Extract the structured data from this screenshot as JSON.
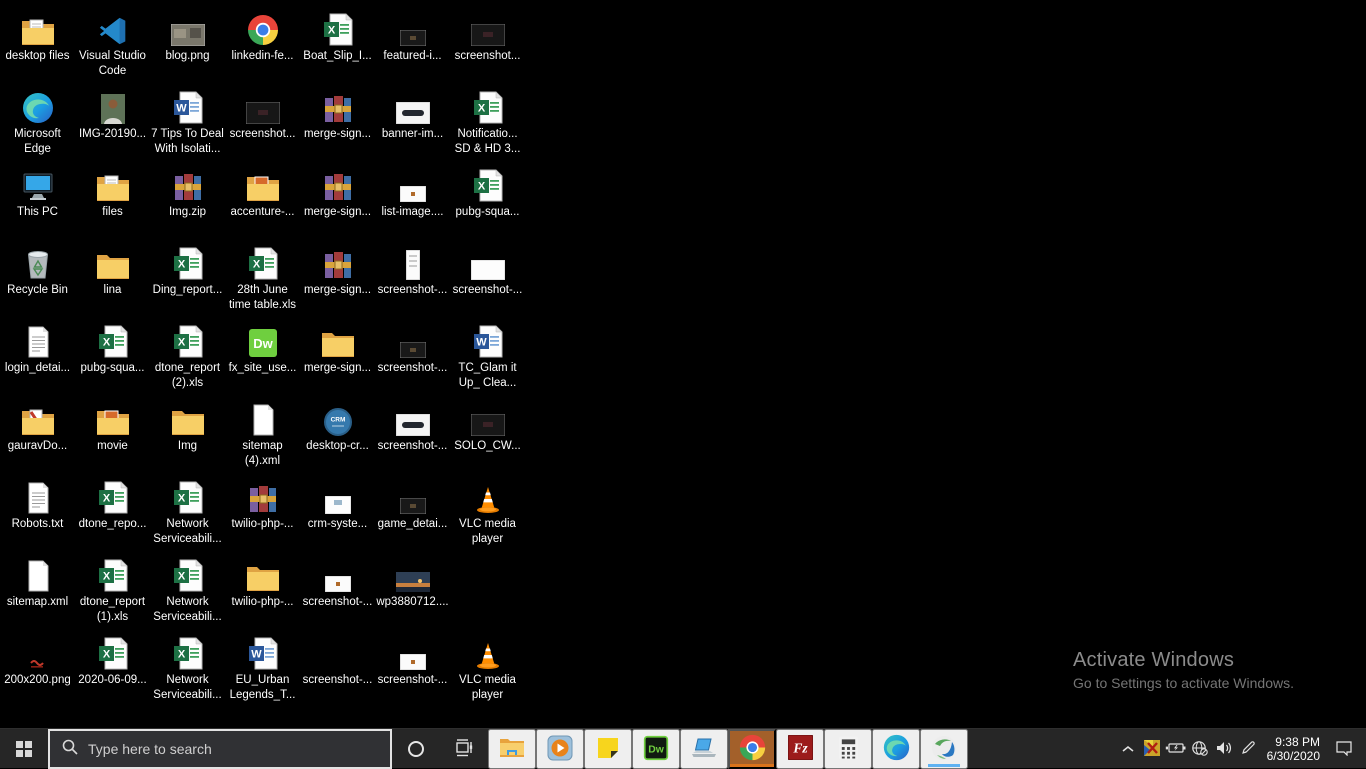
{
  "colors": {
    "wallpaper": "#000000",
    "taskbar": "#262626",
    "active_app_highlight": "#a3602a",
    "active_app_underline": "#d9731c",
    "running_app_underline": "#5fb2f2",
    "icon_label": "#ffffff",
    "watermark_text": "#8b8b8b"
  },
  "desktop": {
    "icons": [
      {
        "row": 0,
        "col": 0,
        "label": "desktop files",
        "icon": "folder_docs"
      },
      {
        "row": 0,
        "col": 1,
        "label": "Visual Studio Code",
        "icon": "vscode"
      },
      {
        "row": 0,
        "col": 2,
        "label": "blog.png",
        "icon": "img_gray"
      },
      {
        "row": 0,
        "col": 3,
        "label": "linkedin-fe...",
        "icon": "chrome"
      },
      {
        "row": 0,
        "col": 4,
        "label": "Boat_Slip_I...",
        "icon": "excel"
      },
      {
        "row": 0,
        "col": 5,
        "label": "featured-i...",
        "icon": "img_dark_sm"
      },
      {
        "row": 0,
        "col": 6,
        "label": "screenshot...",
        "icon": "img_dark"
      },
      {
        "row": 1,
        "col": 0,
        "label": "Microsoft Edge",
        "icon": "edge"
      },
      {
        "row": 1,
        "col": 1,
        "label": "IMG-20190...",
        "icon": "photo"
      },
      {
        "row": 1,
        "col": 2,
        "label": "7 Tips To Deal With Isolati...",
        "icon": "word"
      },
      {
        "row": 1,
        "col": 3,
        "label": "screenshot...",
        "icon": "img_dark"
      },
      {
        "row": 1,
        "col": 4,
        "label": "merge-sign...",
        "icon": "winrar"
      },
      {
        "row": 1,
        "col": 5,
        "label": "banner-im...",
        "icon": "img_band"
      },
      {
        "row": 1,
        "col": 6,
        "label": "Notificatio... SD & HD 3...",
        "icon": "excel"
      },
      {
        "row": 2,
        "col": 0,
        "label": "This PC",
        "icon": "thispc"
      },
      {
        "row": 2,
        "col": 1,
        "label": "files",
        "icon": "folder_docs"
      },
      {
        "row": 2,
        "col": 2,
        "label": "Img.zip",
        "icon": "winrar"
      },
      {
        "row": 2,
        "col": 3,
        "label": "accenture-...",
        "icon": "folder_img"
      },
      {
        "row": 2,
        "col": 4,
        "label": "merge-sign...",
        "icon": "winrar"
      },
      {
        "row": 2,
        "col": 5,
        "label": "list-image....",
        "icon": "img_sm_white"
      },
      {
        "row": 2,
        "col": 6,
        "label": "pubg-squa...",
        "icon": "excel"
      },
      {
        "row": 3,
        "col": 0,
        "label": "Recycle Bin",
        "icon": "recyclebin"
      },
      {
        "row": 3,
        "col": 1,
        "label": "lina",
        "icon": "folder"
      },
      {
        "row": 3,
        "col": 2,
        "label": "Ding_report...",
        "icon": "excel"
      },
      {
        "row": 3,
        "col": 3,
        "label": "28th June time table.xls",
        "icon": "excel"
      },
      {
        "row": 3,
        "col": 4,
        "label": "merge-sign...",
        "icon": "winrar"
      },
      {
        "row": 3,
        "col": 5,
        "label": "screenshot-...",
        "icon": "img_tall"
      },
      {
        "row": 3,
        "col": 6,
        "label": "screenshot-...",
        "icon": "img_white"
      },
      {
        "row": 4,
        "col": 0,
        "label": "login_detai...",
        "icon": "textdoc"
      },
      {
        "row": 4,
        "col": 1,
        "label": "pubg-squa...",
        "icon": "excel"
      },
      {
        "row": 4,
        "col": 2,
        "label": "dtone_report (2).xls",
        "icon": "excel"
      },
      {
        "row": 4,
        "col": 3,
        "label": "fx_site_use...",
        "icon": "dreamweaver"
      },
      {
        "row": 4,
        "col": 4,
        "label": "merge-sign...",
        "icon": "folder"
      },
      {
        "row": 4,
        "col": 5,
        "label": "screenshot-...",
        "icon": "img_dark_sm"
      },
      {
        "row": 4,
        "col": 6,
        "label": "TC_Glam it Up_ Clea...",
        "icon": "word"
      },
      {
        "row": 5,
        "col": 0,
        "label": "gauravDo...",
        "icon": "folder_pdf"
      },
      {
        "row": 5,
        "col": 1,
        "label": "movie",
        "icon": "folder_img"
      },
      {
        "row": 5,
        "col": 2,
        "label": "Img",
        "icon": "folder"
      },
      {
        "row": 5,
        "col": 3,
        "label": "sitemap (4).xml",
        "icon": "blankdoc"
      },
      {
        "row": 5,
        "col": 4,
        "label": "desktop-cr...",
        "icon": "crm"
      },
      {
        "row": 5,
        "col": 5,
        "label": "screenshot-...",
        "icon": "img_band"
      },
      {
        "row": 5,
        "col": 6,
        "label": "SOLO_CW...",
        "icon": "img_dark"
      },
      {
        "row": 6,
        "col": 0,
        "label": "Robots.txt",
        "icon": "textdoc"
      },
      {
        "row": 6,
        "col": 1,
        "label": "dtone_repo...",
        "icon": "excel"
      },
      {
        "row": 6,
        "col": 2,
        "label": "Network Serviceabili...",
        "icon": "excel"
      },
      {
        "row": 6,
        "col": 3,
        "label": "twilio-php-...",
        "icon": "winrar"
      },
      {
        "row": 6,
        "col": 4,
        "label": "crm-syste...",
        "icon": "img_white_sq"
      },
      {
        "row": 6,
        "col": 5,
        "label": "game_detai...",
        "icon": "img_dark_sm"
      },
      {
        "row": 6,
        "col": 6,
        "label": "VLC media player",
        "icon": "vlc"
      },
      {
        "row": 7,
        "col": 0,
        "label": "sitemap.xml",
        "icon": "blankdoc"
      },
      {
        "row": 7,
        "col": 1,
        "label": "dtone_report (1).xls",
        "icon": "excel"
      },
      {
        "row": 7,
        "col": 2,
        "label": "Network Serviceabili...",
        "icon": "excel"
      },
      {
        "row": 7,
        "col": 3,
        "label": "twilio-php-...",
        "icon": "folder"
      },
      {
        "row": 7,
        "col": 4,
        "label": "screenshot-...",
        "icon": "img_sm_white"
      },
      {
        "row": 7,
        "col": 5,
        "label": "wp3880712....",
        "icon": "img_land"
      },
      {
        "row": 8,
        "col": 0,
        "label": "200x200.png",
        "icon": "img_red"
      },
      {
        "row": 8,
        "col": 1,
        "label": "2020-06-09...",
        "icon": "excel"
      },
      {
        "row": 8,
        "col": 2,
        "label": "Network Serviceabili...",
        "icon": "excel"
      },
      {
        "row": 8,
        "col": 3,
        "label": "EU_Urban Legends_T...",
        "icon": "word"
      },
      {
        "row": 8,
        "col": 4,
        "label": "screenshot-...",
        "icon": "img_sm"
      },
      {
        "row": 8,
        "col": 5,
        "label": "screenshot-...",
        "icon": "img_sm_white"
      },
      {
        "row": 8,
        "col": 6,
        "label": "VLC media player",
        "icon": "vlc"
      }
    ]
  },
  "watermark": {
    "title": "Activate Windows",
    "subtitle": "Go to Settings to activate Windows."
  },
  "taskbar": {
    "search_placeholder": "Type here to search",
    "apps": [
      {
        "name": "file-explorer",
        "icon": "fx_folder"
      },
      {
        "name": "windows-media-player",
        "icon": "wmp"
      },
      {
        "name": "sticky-notes",
        "icon": "sticky"
      },
      {
        "name": "dreamweaver",
        "icon": "dw_task"
      },
      {
        "name": "remote-pc",
        "icon": "laptop"
      },
      {
        "name": "chrome",
        "icon": "chrome_task",
        "active": true
      },
      {
        "name": "filezilla",
        "icon": "filezilla"
      },
      {
        "name": "calculator",
        "icon": "calc"
      },
      {
        "name": "edge",
        "icon": "edge_task"
      },
      {
        "name": "cisco-anyconnect",
        "icon": "cisco",
        "running": true
      }
    ],
    "tray": {
      "time": "9:38 PM",
      "date": "6/30/2020",
      "icons": [
        {
          "name": "hidden-icons-chevron",
          "icon": "chevron"
        },
        {
          "name": "tray-app",
          "icon": "trayapp"
        },
        {
          "name": "battery",
          "icon": "battery"
        },
        {
          "name": "network-no-internet",
          "icon": "globe"
        },
        {
          "name": "volume",
          "icon": "volume"
        },
        {
          "name": "windows-ink",
          "icon": "pen"
        }
      ]
    }
  }
}
